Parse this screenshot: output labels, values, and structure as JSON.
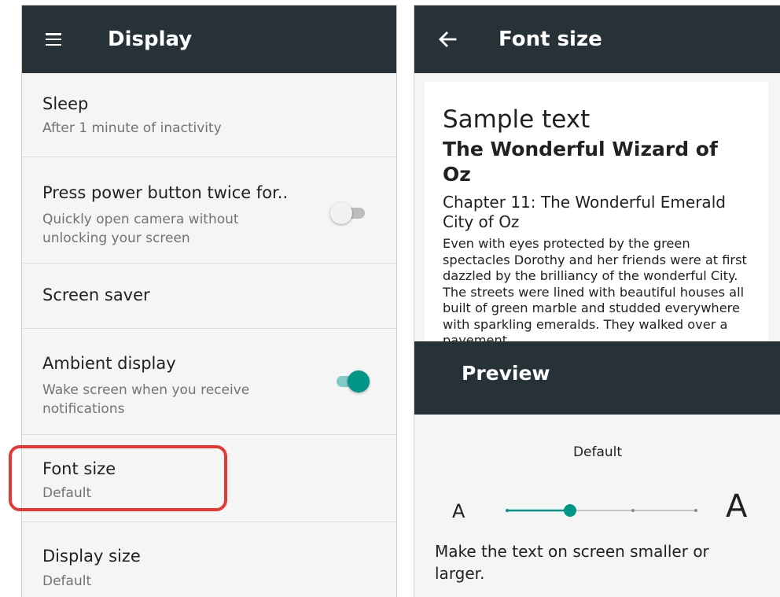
{
  "display_screen": {
    "title": "Display",
    "items": [
      {
        "title": "Sleep",
        "summary": "After 1 minute of inactivity"
      },
      {
        "title": "Press power button twice for..",
        "summary": "Quickly open camera without unlocking your screen",
        "toggle": "off"
      },
      {
        "title": "Screen saver"
      },
      {
        "title": "Ambient display",
        "summary": "Wake screen when you receive notifications",
        "toggle": "on"
      },
      {
        "title": "Font size",
        "summary": "Default"
      },
      {
        "title": "Display size",
        "summary": "Default"
      }
    ]
  },
  "font_size_screen": {
    "title": "Font size",
    "preview": {
      "sample": "Sample text",
      "book_title": "The Wonderful Wizard of Oz",
      "chapter": "Chapter 11: The Wonderful Emerald City of Oz",
      "body": "Even with eyes protected by the green spectacles Dorothy and her friends were at first dazzled by the brilliancy of the wonderful City. The streets were lined with beautiful houses all built of green marble and studded everywhere with sparkling emeralds. They walked over a pavement"
    },
    "preview_label": "Preview",
    "size_label": "Default",
    "small_a": "A",
    "large_a": "A",
    "description": "Make the text on screen smaller or larger.",
    "slider": {
      "steps": 4,
      "selected_index": 1
    }
  },
  "colors": {
    "app_bar": "#263238",
    "accent": "#009688",
    "highlight": "#e53935"
  },
  "icons": {
    "left_nav": "menu-icon",
    "right_nav": "back-arrow-icon"
  }
}
